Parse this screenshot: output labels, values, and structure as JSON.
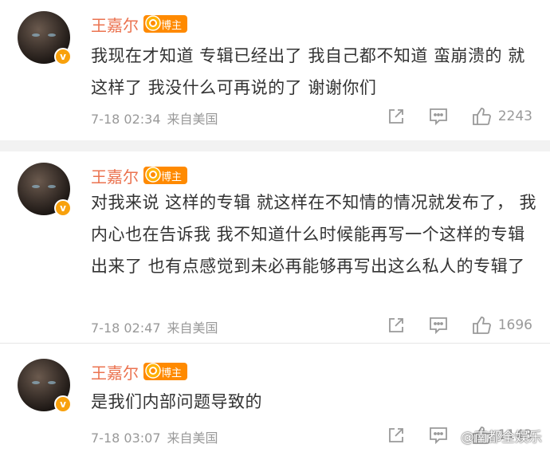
{
  "comments": [
    {
      "username": "王嘉尔",
      "tag": "博主",
      "text": "我现在才知道 专辑已经出了 我自己都不知道 蛮崩溃的  就这样了 我没什么可再说的了  谢谢你们",
      "time": "7-18 02:34",
      "source": "来自美国",
      "likes": "2243"
    },
    {
      "username": "王嘉尔",
      "tag": "博主",
      "text": "对我来说 这样的专辑 就这样在不知情的情况就发布了，  我内心也在告诉我 我不知道什么时候能再写一个这样的专辑出来了 也有点感觉到未必再能够再写出这么私人的专辑了",
      "time": "7-18 02:47",
      "source": "来自美国",
      "likes": "1696"
    },
    {
      "username": "王嘉尔",
      "tag": "博主",
      "text": "是我们内部问题导致的",
      "time": "7-18 03:07",
      "source": "来自美国",
      "likes": "1143"
    }
  ],
  "watermark": "@南都全娱乐",
  "colors": {
    "name": "#eb7350",
    "tag_bg": "#ff8a00",
    "meta": "#999999",
    "text": "#333333"
  },
  "icons": {
    "verified": "v-badge-icon",
    "share": "share-icon",
    "comment": "comment-icon",
    "like": "thumbs-up-icon"
  }
}
